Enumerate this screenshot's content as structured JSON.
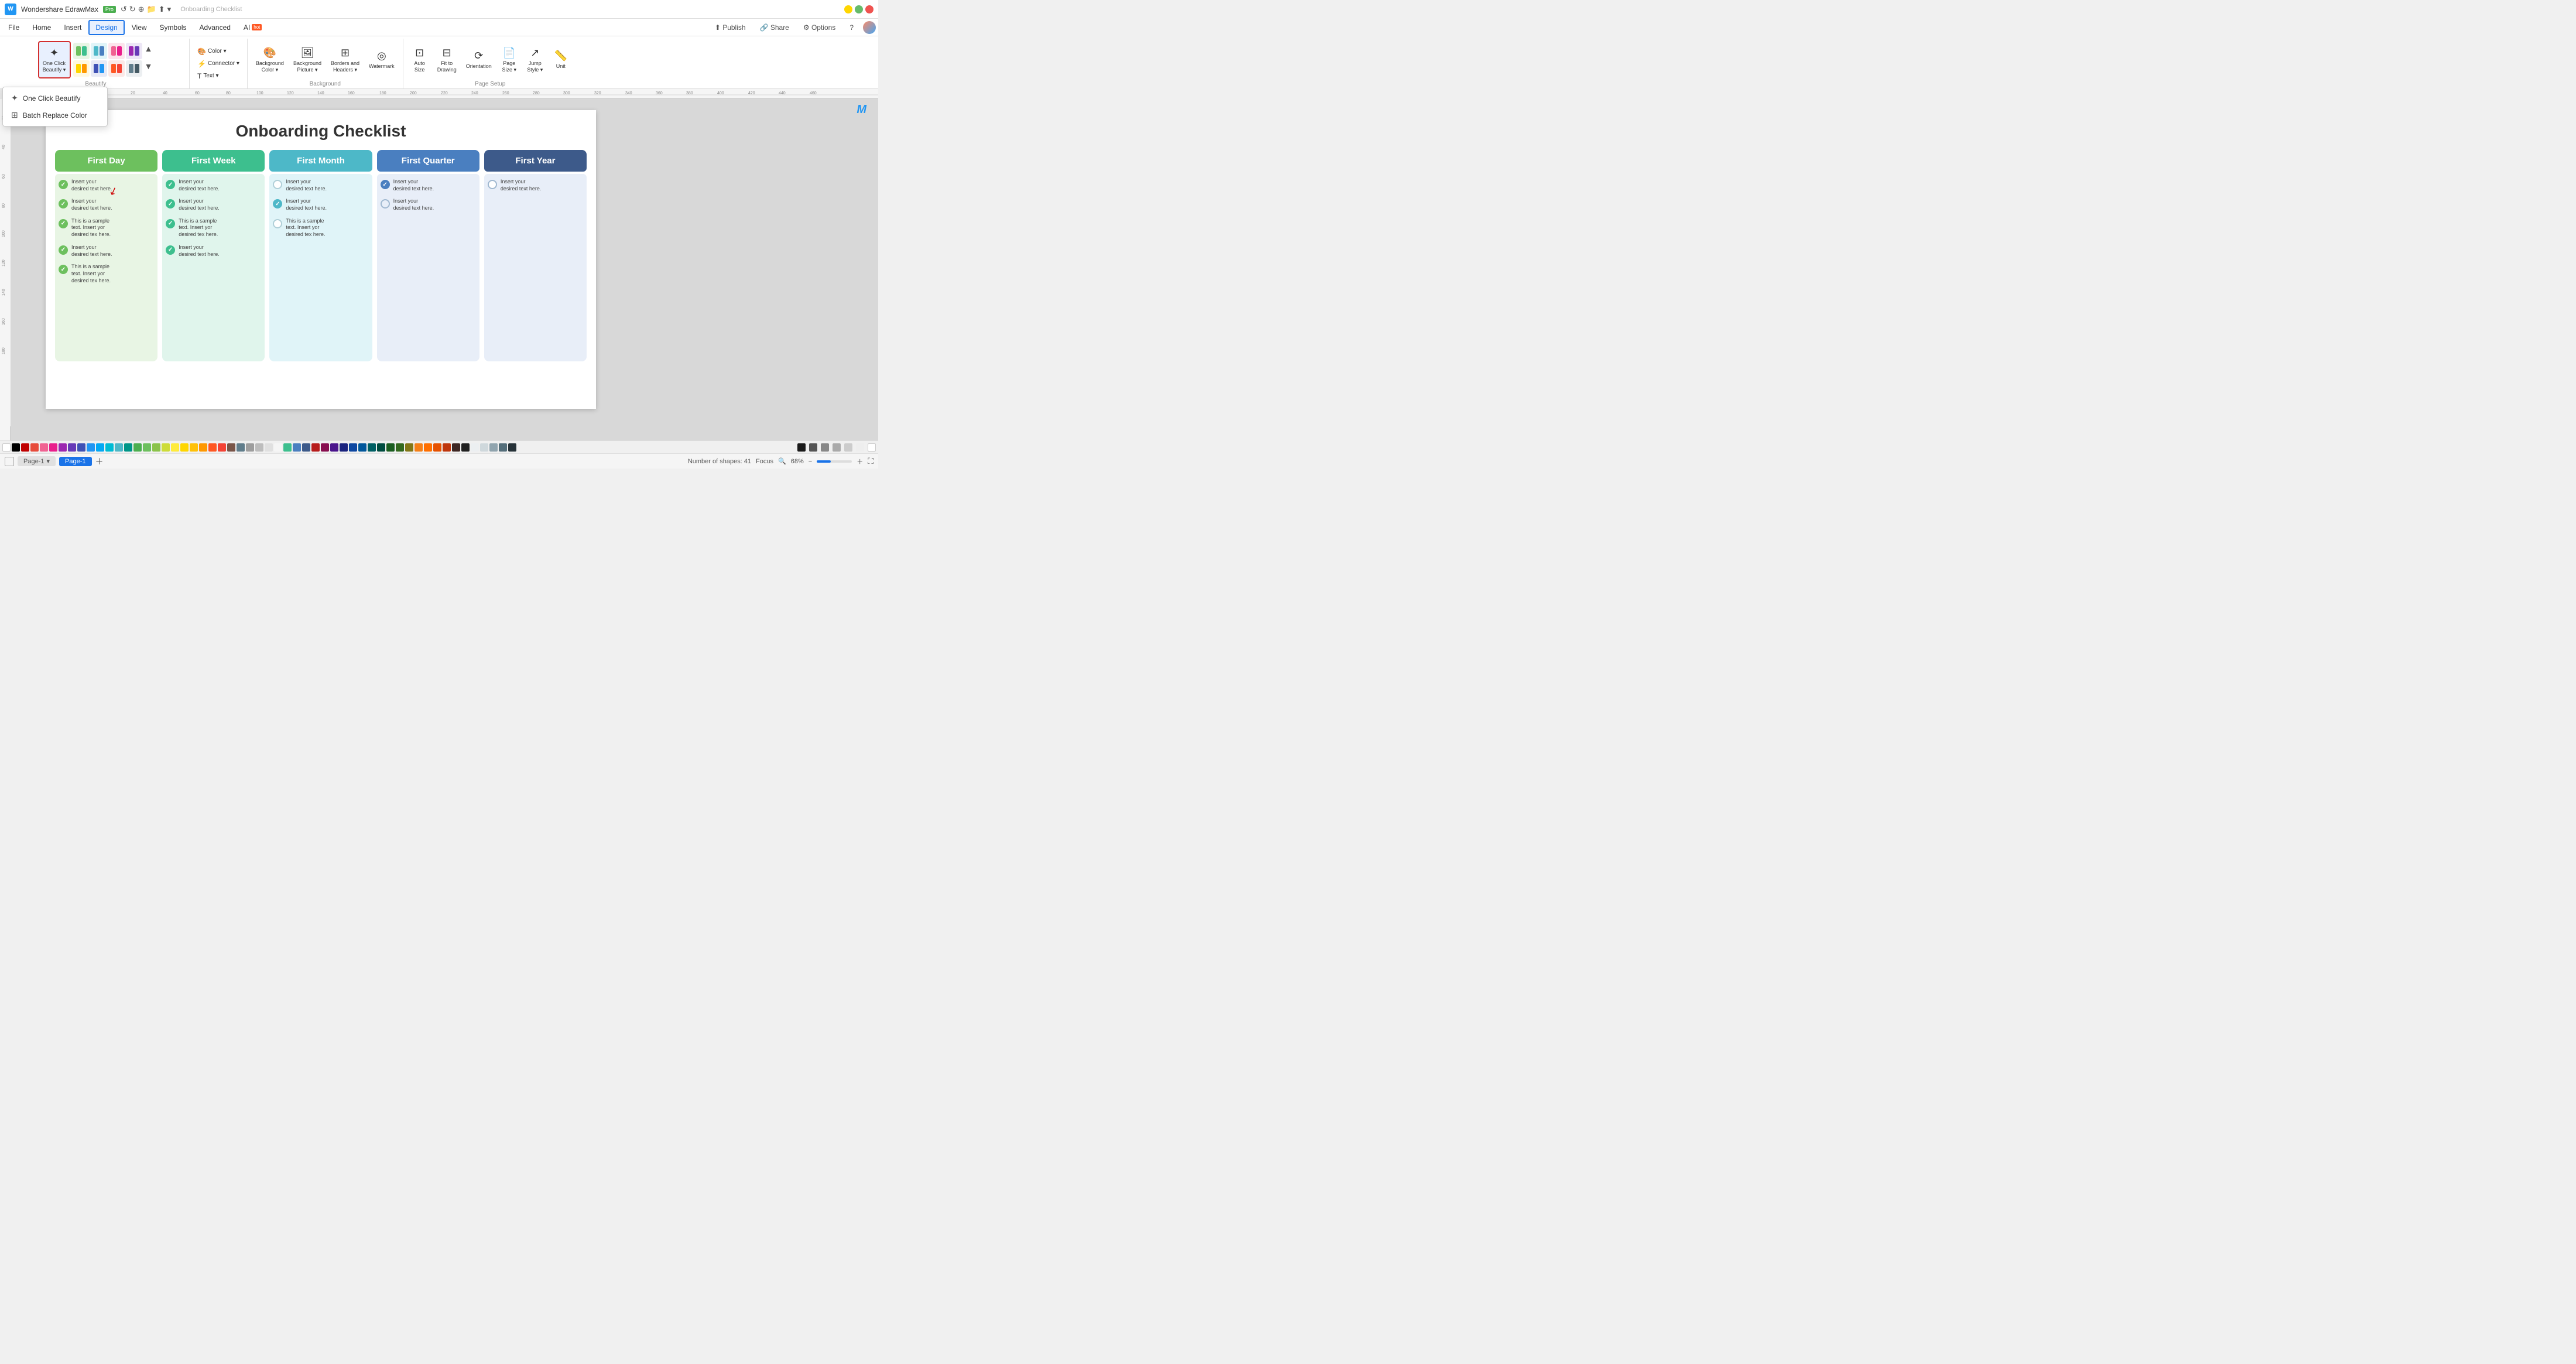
{
  "app": {
    "title": "Wondershare EdrawMax",
    "badge": "Pro",
    "undo_icon": "↺",
    "redo_icon": "↻"
  },
  "menu": {
    "items": [
      "File",
      "Home",
      "Insert",
      "Design",
      "View",
      "Symbols",
      "Advanced"
    ],
    "active": "Design",
    "right_items": [
      "Publish",
      "Share",
      "Options",
      "?"
    ]
  },
  "ribbon": {
    "beautify_group": {
      "label": "Beautify",
      "one_click_label": "One Click\nBeautify",
      "buttons": [
        "style1",
        "style2",
        "style3",
        "style4",
        "style5",
        "style6",
        "style7",
        "style8"
      ],
      "expand_icon": "⌄"
    },
    "color_group": {
      "color_btn": "Color",
      "connector_btn": "Connector",
      "text_btn": "Text"
    },
    "background_group": {
      "label": "Background",
      "bg_color_label": "Background\nColor",
      "bg_picture_label": "Background\nPicture",
      "borders_label": "Borders and\nHeaders",
      "watermark_label": "Watermark"
    },
    "page_setup_group": {
      "label": "Page Setup",
      "auto_size_label": "Auto\nSize",
      "fit_to_drawing_label": "Fit to\nDrawing",
      "orientation_label": "Orientation",
      "page_size_label": "Page\nSize",
      "jump_style_label": "Jump\nStyle",
      "unit_label": "Unit"
    }
  },
  "dropdown": {
    "items": [
      {
        "icon": "✦",
        "label": "One Click Beautify"
      },
      {
        "icon": "⊞",
        "label": "Batch Replace Color"
      }
    ]
  },
  "canvas": {
    "title": "Onboarding Checklist",
    "columns": [
      {
        "header": "First Day",
        "header_color": "#6dc05e",
        "body_color": "#e8f5e4",
        "check_color": "#6dc05e",
        "check_type": "check",
        "items": [
          "Insert your\ndesired text here.",
          "Insert your\ndesired text here.",
          "This is a sample\ntext. Insert yor\ndesired tex here.",
          "Insert your\ndesired text here.",
          "This is a sample\ntext. Insert yor\ndesired tex here."
        ]
      },
      {
        "header": "First Week",
        "header_color": "#3dbf8e",
        "body_color": "#e0f5ec",
        "check_color": "#3dbf8e",
        "check_type": "check",
        "items": [
          "Insert your\ndesired text here.",
          "Insert your\ndesired text here.",
          "This is a sample\ntext. Insert yor\ndesired tex here.",
          "Insert your\ndesired text here."
        ]
      },
      {
        "header": "First Month",
        "header_color": "#4db8c8",
        "body_color": "#e0f4f8",
        "check_color": "#b0cfd8",
        "check_type": "circle",
        "items": [
          "Insert your\ndesired text here.",
          "Insert your\ndesired text here.",
          "This is a sample\ntext. Insert yor\ndesired tex here."
        ]
      },
      {
        "header": "First Quarter",
        "header_color": "#4a7fc0",
        "body_color": "#e8eef8",
        "check_color": "#7da8d8",
        "check_type": "mixed",
        "items": [
          "Insert your\ndesired text here.",
          "Insert your\ndesired text here."
        ]
      },
      {
        "header": "First Year",
        "header_color": "#3d5a8a",
        "body_color": "#e8eef8",
        "check_color": "#a0b8d0",
        "check_type": "circle",
        "items": [
          "Insert your\ndesired text here."
        ]
      }
    ]
  },
  "statusbar": {
    "page_tabs": [
      "Page-1"
    ],
    "active_tab": "Page-1",
    "shapes_label": "Number of shapes: 41",
    "focus_label": "Focus",
    "zoom_level": "68%"
  },
  "colors": [
    "#ffffff",
    "#000000",
    "#c00000",
    "#e74c3c",
    "#f06292",
    "#e91e8c",
    "#9c27b0",
    "#3f51b5",
    "#2196f3",
    "#03a9f4",
    "#00bcd4",
    "#009688",
    "#4caf50",
    "#8bc34a",
    "#cddc39",
    "#ffeb3b",
    "#ffc107",
    "#ff9800",
    "#ff5722",
    "#795548",
    "#607d8b",
    "#9e9e9e",
    "#f5f5f5",
    "#e0e0e0",
    "#bdbdbd",
    "#757575",
    "#424242",
    "#b71c1c",
    "#880e4f",
    "#4a148c",
    "#311b92",
    "#1a237e",
    "#0d47a1",
    "#01579b",
    "#006064",
    "#004d40",
    "#1b5e20",
    "#33691e",
    "#827717",
    "#f57f17",
    "#ff6f00",
    "#e65100",
    "#bf360c",
    "#3e2723",
    "#212121",
    "#eceff1",
    "#cfd8dc",
    "#b0bec5",
    "#90a4ae",
    "#78909c",
    "#546e7a",
    "#455a64",
    "#37474f",
    "#263238"
  ]
}
